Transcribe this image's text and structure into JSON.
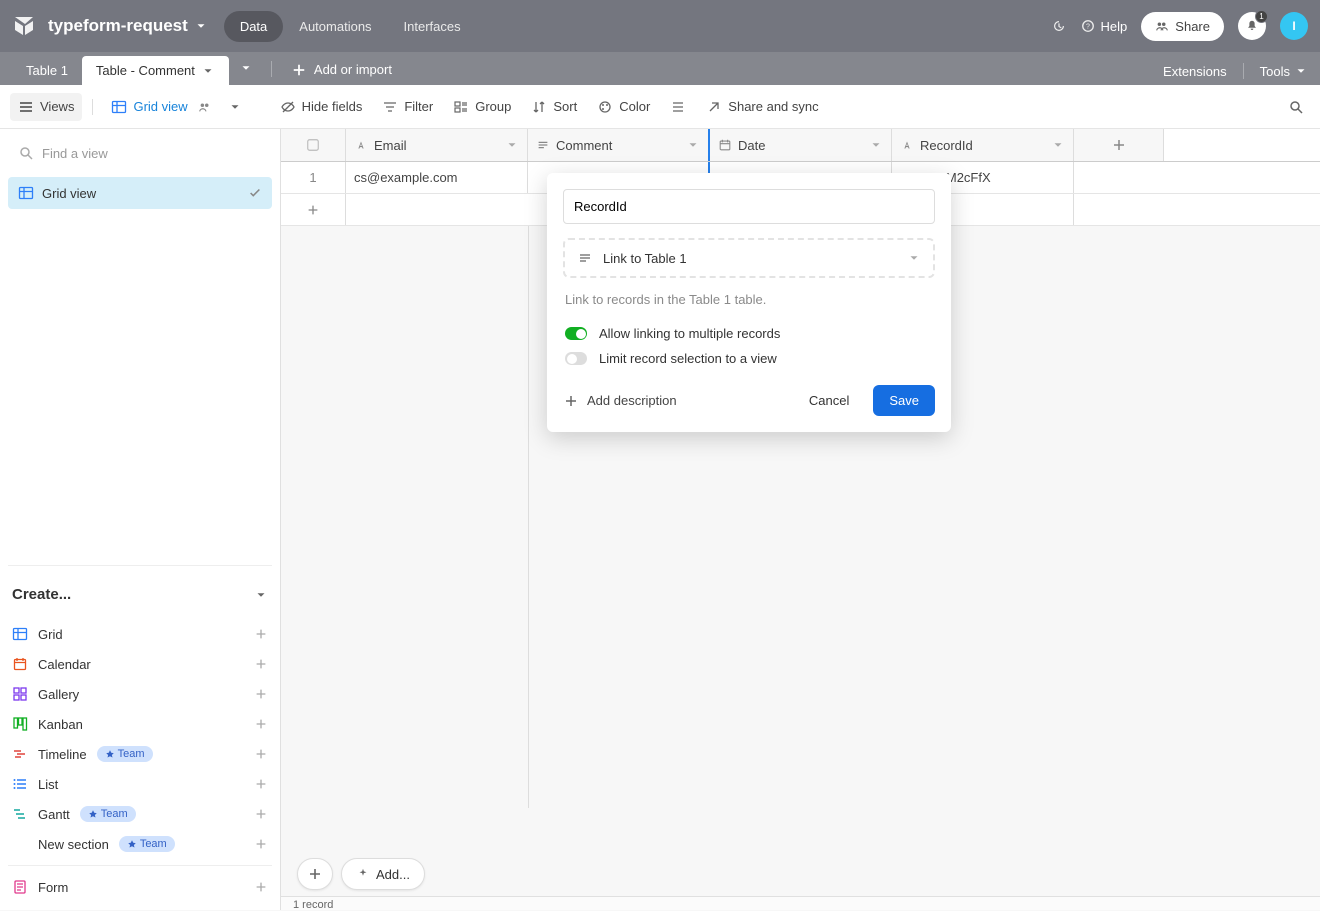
{
  "header": {
    "base_name": "typeform-request",
    "tabs": [
      "Data",
      "Automations",
      "Interfaces"
    ],
    "active_tab": 0,
    "help": "Help",
    "share": "Share",
    "notifications_count": "1",
    "avatar_initial": "I"
  },
  "tabbar": {
    "tabs": [
      "Table 1",
      "Table - Comment"
    ],
    "active": 1,
    "add_import": "Add or import",
    "extensions": "Extensions",
    "tools": "Tools"
  },
  "toolbar": {
    "views": "Views",
    "grid_view": "Grid view",
    "hide_fields": "Hide fields",
    "filter": "Filter",
    "group": "Group",
    "sort": "Sort",
    "color": "Color",
    "share_sync": "Share and sync"
  },
  "sidebar": {
    "find_placeholder": "Find a view",
    "views": [
      {
        "label": "Grid view",
        "selected": true
      }
    ],
    "create_label": "Create...",
    "create_items": [
      {
        "label": "Grid",
        "icon": "grid",
        "color": "#2d7ff9"
      },
      {
        "label": "Calendar",
        "icon": "calendar",
        "color": "#e9541f"
      },
      {
        "label": "Gallery",
        "icon": "gallery",
        "color": "#7c39ed"
      },
      {
        "label": "Kanban",
        "icon": "kanban",
        "color": "#11af22"
      },
      {
        "label": "Timeline",
        "icon": "timeline",
        "color": "#e0433c",
        "team": true
      },
      {
        "label": "List",
        "icon": "list",
        "color": "#2d7ff9"
      },
      {
        "label": "Gantt",
        "icon": "gantt",
        "color": "#15a99f",
        "team": true
      },
      {
        "label": "New section",
        "icon": "",
        "team": true
      }
    ],
    "form_label": "Form",
    "team_badge": "Team"
  },
  "grid": {
    "columns": [
      {
        "label": "Email",
        "icon": "text"
      },
      {
        "label": "Comment",
        "icon": "longtext"
      },
      {
        "label": "Date",
        "icon": "date"
      },
      {
        "label": "RecordId",
        "icon": "text"
      }
    ],
    "rows": [
      {
        "num": "1",
        "email": "cs@example.com",
        "comment": "",
        "date": "",
        "recordid": "recMqEy8XPM2cFfX"
      }
    ],
    "footer_add": "Add...",
    "record_count": "1 record"
  },
  "popup": {
    "field_name": "RecordId",
    "type_label": "Link to Table 1",
    "description": "Link to records in the Table 1 table.",
    "allow_multiple": "Allow linking to multiple records",
    "limit_view": "Limit record selection to a view",
    "add_description": "Add description",
    "cancel": "Cancel",
    "save": "Save"
  }
}
